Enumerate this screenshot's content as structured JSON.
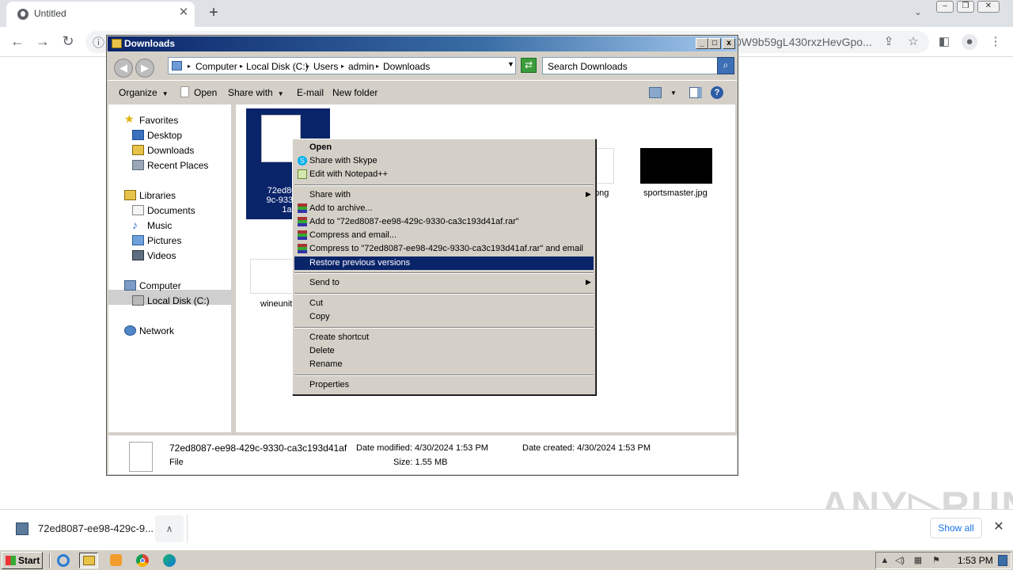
{
  "browser": {
    "tab_title": "Untitled",
    "tab_close": "✕",
    "new_tab": "+",
    "url_visible": "0W9b59gL430rxzHevGpo...",
    "back": "←",
    "forward": "→",
    "reload": "↻",
    "info": "ⓘ"
  },
  "explorer": {
    "title": "Downloads",
    "breadcrumb": [
      "Computer",
      "Local Disk (C:)",
      "Users",
      "admin",
      "Downloads"
    ],
    "breadcrumb_sep": "▸",
    "search_placeholder": "Search Downloads",
    "commands": {
      "organize": "Organize",
      "open": "Open",
      "share_with": "Share with",
      "email": "E-mail",
      "new_folder": "New folder"
    },
    "nav": {
      "favorites": "Favorites",
      "desktop": "Desktop",
      "downloads": "Downloads",
      "recent_places": "Recent Places",
      "libraries": "Libraries",
      "documents": "Documents",
      "music": "Music",
      "pictures": "Pictures",
      "videos": "Videos",
      "computer": "Computer",
      "local_disk": "Local Disk (C:)",
      "network": "Network"
    },
    "files": {
      "selected_line1": "72ed8087-",
      "selected_line2": "9c-9330-ca",
      "selected_line3": "1af",
      "png_partial": ".png",
      "sportsmaster": "sportsmaster.jpg",
      "wineunit": "wineunit"
    },
    "details": {
      "name": "72ed8087-ee98-429c-9330-ca3c193d41af",
      "type": "File",
      "date_modified": "Date modified: 4/30/2024 1:53 PM",
      "size": "Size: 1.55 MB",
      "date_created": "Date created: 4/30/2024 1:53 PM"
    }
  },
  "context_menu": {
    "open": "Open",
    "share_skype": "Share with Skype",
    "edit_notepad": "Edit with Notepad++",
    "share_with": "Share with",
    "add_archive": "Add to archive...",
    "add_rar": "Add to \"72ed8087-ee98-429c-9330-ca3c193d41af.rar\"",
    "compress_email": "Compress and email...",
    "compress_rar_email": "Compress to \"72ed8087-ee98-429c-9330-ca3c193d41af.rar\" and email",
    "restore_versions": "Restore previous versions",
    "send_to": "Send to",
    "cut": "Cut",
    "copy": "Copy",
    "create_shortcut": "Create shortcut",
    "delete": "Delete",
    "rename": "Rename",
    "properties": "Properties"
  },
  "download_bar": {
    "filename": "72ed8087-ee98-429c-9...",
    "show_all": "Show all",
    "close": "✕",
    "chevron": "∧"
  },
  "watermark": "ANY▷RUN",
  "taskbar": {
    "start": "Start",
    "clock": "1:53 PM"
  },
  "colors": {
    "selection": "#0a246a",
    "chrome_tabbar": "#dee1e6",
    "classic_face": "#d4d0c8",
    "link_blue": "#1a73e8"
  }
}
